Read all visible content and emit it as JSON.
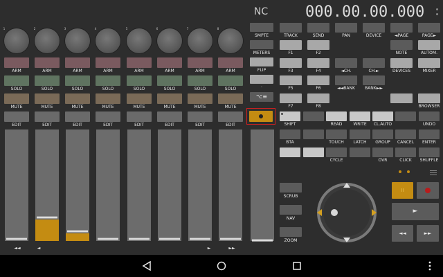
{
  "status": {
    "name": "NC",
    "counter": "000.00.00.000"
  },
  "channels": {
    "numbers": [
      "1",
      "2",
      "3",
      "4",
      "5",
      "6",
      "7",
      "8"
    ],
    "arm_label": "ARM",
    "solo_label": "SOLO",
    "mute_label": "MUTE",
    "edit_label": "EDIT",
    "fader_levels": [
      0,
      0.19,
      0.07,
      0,
      0,
      0,
      0,
      0
    ],
    "master_level": 0
  },
  "bank_nav": {
    "bank_left": "◄◄",
    "channel_left": "◄",
    "channel_right": "►",
    "bank_right": "►►"
  },
  "mid_column": {
    "smpte": "SMPTE",
    "meters": "METERS",
    "flip": "FLIP",
    "dot": "·",
    "option": "⌥≡"
  },
  "function_keys": {
    "row1": [
      "TRACK",
      "SEND",
      "PAN",
      "DEVICE",
      "◄PAGE",
      "PAGE►"
    ],
    "row2": [
      "F1",
      "F2",
      "",
      "",
      "NOTE",
      "AUTOM."
    ],
    "row3": [
      "F3",
      "F4",
      "◄CH.",
      "CH.►",
      "DEVICES",
      "MIXER"
    ],
    "row4": [
      "F5",
      "F6",
      "◄◄BANK",
      "BANK►►",
      "",
      ""
    ],
    "row5": [
      "F7",
      "F8",
      "",
      "",
      "",
      "BROWSER"
    ],
    "row6": [
      "SHIFT",
      "",
      "READ",
      "WRITE",
      "CL.AUTO",
      "",
      "UNDO"
    ],
    "row7": [
      "BTA",
      "",
      "TOUCH",
      "LATCH",
      "GROUP",
      "CANCEL",
      "ENTER"
    ],
    "row8": [
      "",
      "",
      "CYCLE",
      "",
      "OVR",
      "CLICK",
      "SHUFFLE"
    ]
  },
  "transport_side": {
    "scrub": "SCRUB",
    "nav": "NAV",
    "zoom": "ZOOM"
  },
  "transport": {
    "pause": "II",
    "play": "►",
    "rewind": "◄◄",
    "forward": "►►"
  },
  "colors": {
    "accent": "#c48c12",
    "record": "#b81c1c",
    "selected_border": "#d02020"
  }
}
